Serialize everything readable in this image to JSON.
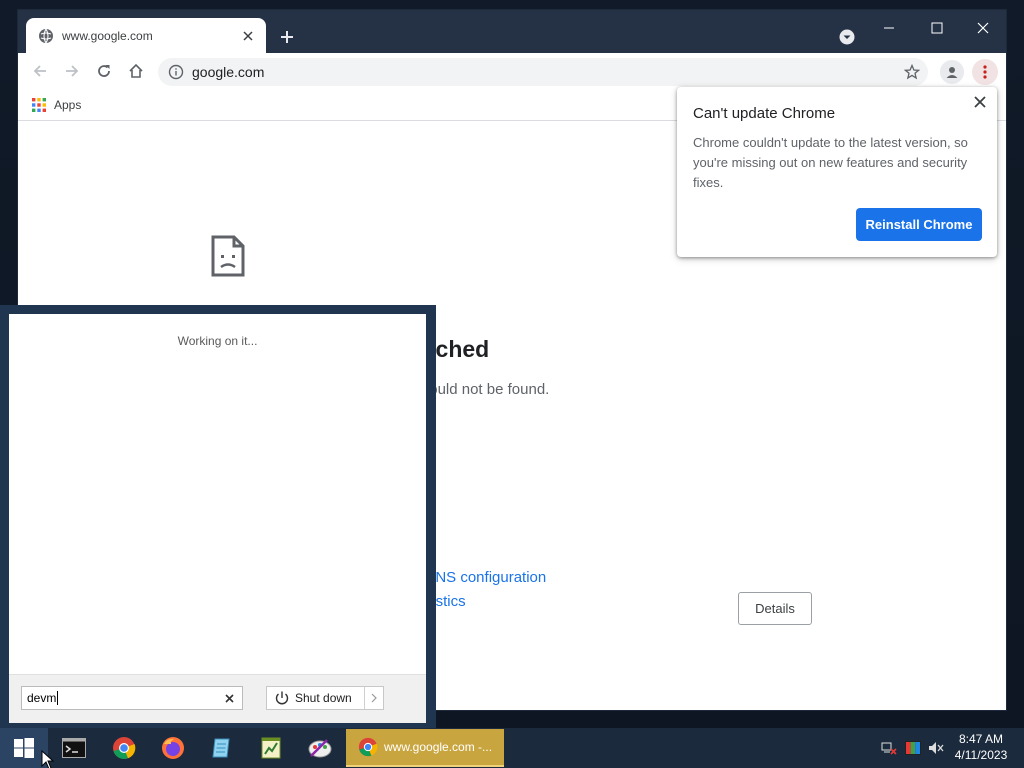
{
  "browser": {
    "tab": {
      "title": "www.google.com"
    },
    "address": {
      "url": "google.com"
    },
    "bookmarks": {
      "apps_label": "Apps"
    }
  },
  "error_page": {
    "title_fragment": "ched",
    "subtitle_fragment": "ress could not be found.",
    "link1_fragment": ", and DNS configuration",
    "link2_fragment": "Diagnostics",
    "details_label": "Details"
  },
  "update_bubble": {
    "title": "Can't update Chrome",
    "body": "Chrome couldn't update to the latest version, so you're missing out on new features and security fixes.",
    "button_label": "Reinstall Chrome"
  },
  "start_search": {
    "status": "Working on it...",
    "query": "devm",
    "shutdown_label": "Shut down"
  },
  "taskbar": {
    "active_task_label": "www.google.com -...",
    "clock": {
      "time": "8:47 AM",
      "date": "4/11/2023"
    }
  },
  "colors": {
    "accent": "#1a73e8",
    "tabstrip": "#253246",
    "taskbar": "#1b2a3c",
    "start_panel": "#1f3550",
    "active_task": "#c9a53f"
  },
  "icons": [
    "globe-icon",
    "close-icon",
    "plus-icon",
    "tab-search-icon",
    "minimize-icon",
    "maximize-icon",
    "back-icon",
    "forward-icon",
    "reload-icon",
    "home-icon",
    "info-icon",
    "star-icon",
    "profile-icon",
    "menu-icon",
    "apps-grid-icon",
    "sad-page-icon",
    "power-icon",
    "windows-logo-icon",
    "terminal-icon",
    "chrome-icon",
    "firefox-icon",
    "notepad-icon",
    "chart-icon",
    "paint-icon",
    "network-icon",
    "color-icon",
    "volume-muted-icon"
  ]
}
